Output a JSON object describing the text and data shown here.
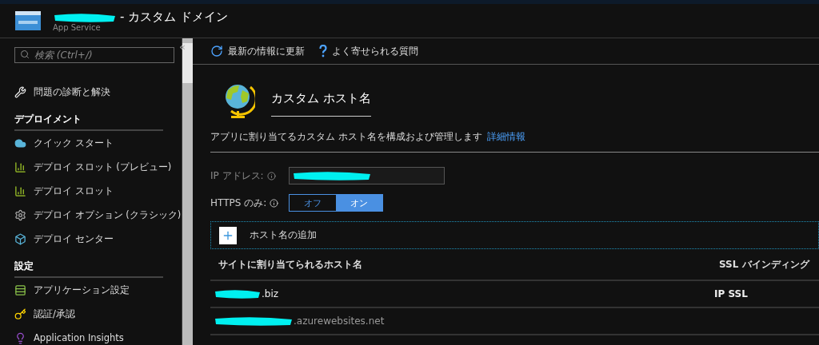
{
  "header": {
    "title": "- カスタム ドメイン",
    "title_redacted": true,
    "subtitle": "App Service"
  },
  "sidebar": {
    "search_placeholder": "検索 (Ctrl+/)",
    "collapse": "«",
    "items": [
      {
        "kind": "item",
        "label": "問題の診断と解決"
      },
      {
        "kind": "section",
        "label": "デプロイメント"
      },
      {
        "kind": "item",
        "label": "クイック スタート"
      },
      {
        "kind": "item",
        "label": "デプロイ スロット (プレビュー)"
      },
      {
        "kind": "item",
        "label": "デプロイ スロット"
      },
      {
        "kind": "item",
        "label": "デプロイ オプション (クラシック)"
      },
      {
        "kind": "item",
        "label": "デプロイ センター"
      },
      {
        "kind": "section",
        "label": "設定"
      },
      {
        "kind": "item",
        "label": "アプリケーション設定"
      },
      {
        "kind": "item",
        "label": "認証/承認"
      },
      {
        "kind": "item",
        "label": "Application Insights"
      }
    ]
  },
  "toolbar": [
    {
      "kind": "refresh",
      "label": "最新の情報に更新"
    },
    {
      "kind": "help",
      "label": "よく寄せられる質問"
    }
  ],
  "section": {
    "title": "カスタム ホスト名",
    "description": "アプリに割り当てるカスタム ホスト名を構成および管理します",
    "link": "詳細情報"
  },
  "ip_address": {
    "label": "IP アドレス:",
    "redacted": true
  },
  "https_only": {
    "label": "HTTPS のみ:",
    "options": [
      {
        "label": "オフ",
        "selected": false
      },
      {
        "label": "オン",
        "selected": true
      }
    ]
  },
  "add_hostname": {
    "label": "ホスト名の追加"
  },
  "table": {
    "columns": [
      "サイトに割り当てられるホスト名",
      "SSL バインディング"
    ],
    "rows": [
      {
        "hostname": ".biz",
        "redacted": true,
        "ssl": "IP SSL",
        "dim": false
      },
      {
        "hostname": ".azurewebsites.net",
        "redacted": true,
        "ssl": "",
        "dim": true
      }
    ]
  }
}
